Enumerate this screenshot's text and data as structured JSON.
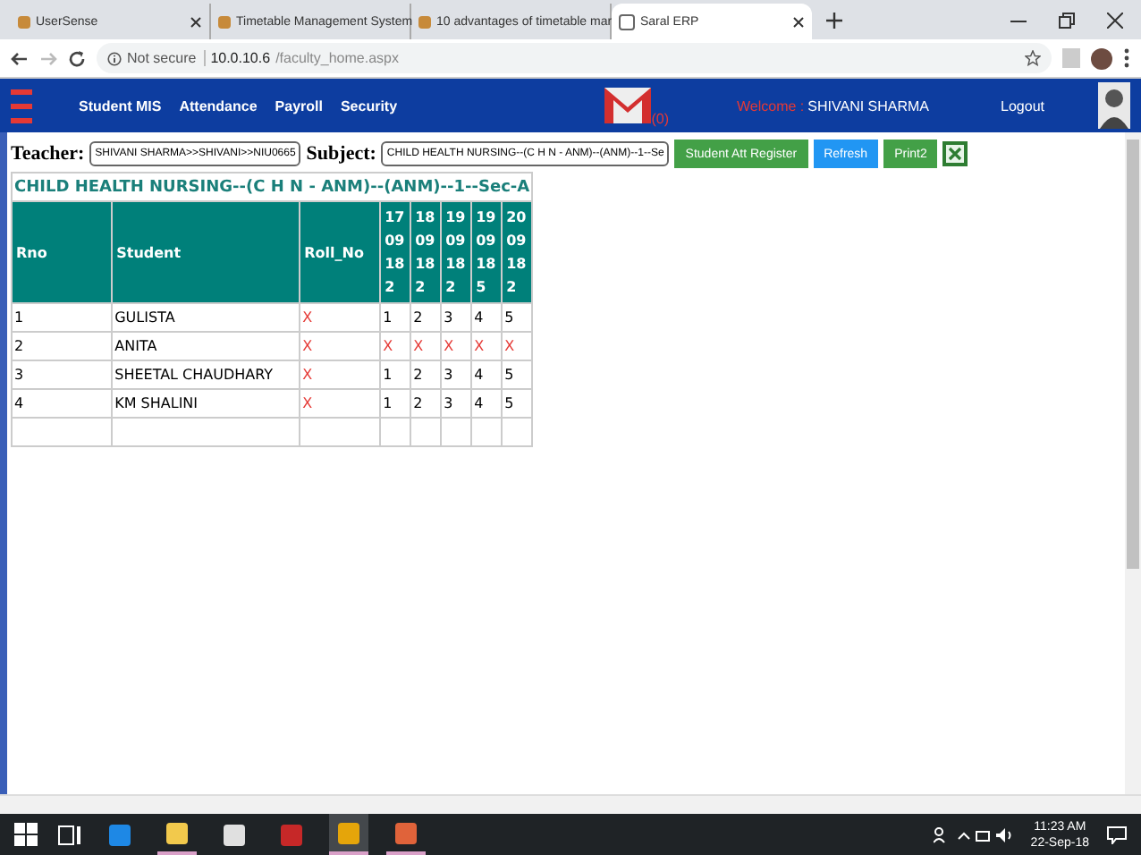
{
  "browser_tabs": [
    {
      "title": "UserSense",
      "selected": false
    },
    {
      "title": "Timetable Management System",
      "selected": false
    },
    {
      "title": "10 advantages of timetable mar",
      "selected": false
    },
    {
      "title": "Saral ERP",
      "selected": true
    }
  ],
  "address_bar": {
    "security": "Not secure",
    "host": "10.0.10.6",
    "path": "/faculty_home.aspx"
  },
  "nav": {
    "items": [
      "Student MIS",
      "Attendance",
      "Payroll",
      "Security"
    ],
    "mail_count": "(0)",
    "welcome_label": "Welcome :",
    "user_name": "SHIVANI SHARMA",
    "logout": "Logout"
  },
  "filters": {
    "teacher_label": "Teacher:",
    "teacher_value": "SHIVANI SHARMA>>SHIVANI>>NIU0665",
    "subject_label": "Subject:",
    "subject_value": "CHILD HEALTH NURSING--(C H N - ANM)--(ANM)--1--Se",
    "buttons": [
      {
        "label": "Student Att Register",
        "kind": "green"
      },
      {
        "label": "Refresh",
        "kind": "blue"
      },
      {
        "label": "Print2",
        "kind": "green"
      }
    ]
  },
  "table": {
    "caption": "CHILD HEALTH NURSING--(C H N - ANM)--(ANM)--1--Sec-A",
    "columns": [
      "Rno",
      "Student",
      "Roll_No",
      "17 09 18 2",
      "18 09 18 2",
      "19 09 18 2",
      "19 09 18 5",
      "20 09 18 2"
    ],
    "rows": [
      {
        "cells": [
          {
            "text": "1",
            "absent": false
          },
          {
            "text": "GULISTA",
            "absent": false
          },
          {
            "text": "X",
            "absent": true
          },
          {
            "text": "1",
            "absent": false
          },
          {
            "text": "2",
            "absent": false
          },
          {
            "text": "3",
            "absent": false
          },
          {
            "text": "4",
            "absent": false
          },
          {
            "text": "5",
            "absent": false
          }
        ]
      },
      {
        "cells": [
          {
            "text": "2",
            "absent": false
          },
          {
            "text": "ANITA",
            "absent": false
          },
          {
            "text": "X",
            "absent": true
          },
          {
            "text": "X",
            "absent": true
          },
          {
            "text": "X",
            "absent": true
          },
          {
            "text": "X",
            "absent": true
          },
          {
            "text": "X",
            "absent": true
          },
          {
            "text": "X",
            "absent": true
          }
        ]
      },
      {
        "cells": [
          {
            "text": "3",
            "absent": false
          },
          {
            "text": "SHEETAL CHAUDHARY",
            "absent": false
          },
          {
            "text": "X",
            "absent": true
          },
          {
            "text": "1",
            "absent": false
          },
          {
            "text": "2",
            "absent": false
          },
          {
            "text": "3",
            "absent": false
          },
          {
            "text": "4",
            "absent": false
          },
          {
            "text": "5",
            "absent": false
          }
        ]
      },
      {
        "cells": [
          {
            "text": "4",
            "absent": false
          },
          {
            "text": "KM SHALINI",
            "absent": false
          },
          {
            "text": "X",
            "absent": true
          },
          {
            "text": "1",
            "absent": false
          },
          {
            "text": "2",
            "absent": false
          },
          {
            "text": "3",
            "absent": false
          },
          {
            "text": "4",
            "absent": false
          },
          {
            "text": "5",
            "absent": false
          }
        ]
      }
    ]
  },
  "taskbar": {
    "apps": [
      {
        "kind": "edge",
        "running": false,
        "selected": false
      },
      {
        "kind": "explorer",
        "running": true,
        "selected": false
      },
      {
        "kind": "store",
        "running": false,
        "selected": false
      },
      {
        "kind": "acrobat",
        "running": false,
        "selected": false
      },
      {
        "kind": "chrome",
        "running": true,
        "selected": true
      },
      {
        "kind": "powerpoint",
        "running": true,
        "selected": false
      }
    ],
    "time": "11:23 AM",
    "date": "22-Sep-18"
  }
}
